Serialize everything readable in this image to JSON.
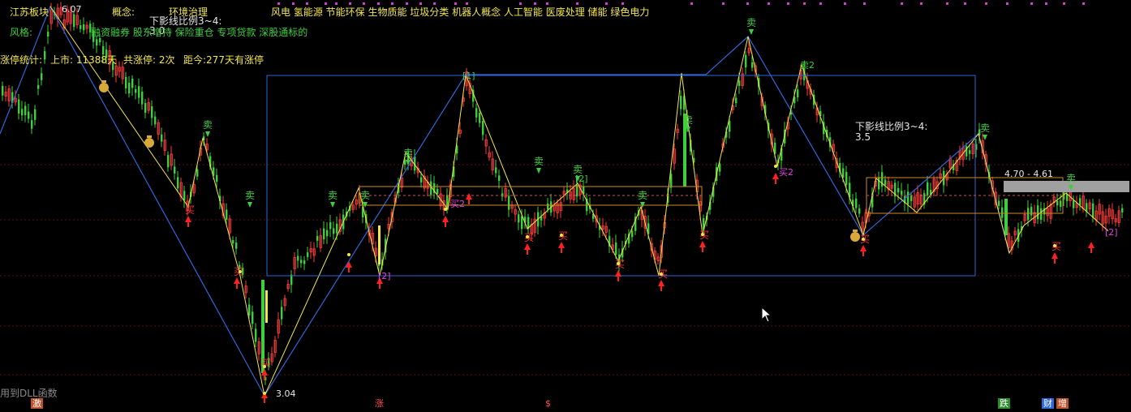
{
  "header": {
    "stock_name": "江苏板块",
    "concept_label": "概念:",
    "concept_primary": "环境治理",
    "concept_list": "风电 氢能源 节能环保 生物质能 垃圾分类 机器人概念 人工智能 医废处理 储能 绿色电力",
    "style_label": "风格:",
    "style_list": "融资融券 股东增持 保险重仓 专项贷款 深股通标的",
    "limit_label": "涨停统计:",
    "limit_days": "上市: 11388天",
    "limit_total": "共涨停: 2次",
    "limit_since": "距今:277天有涨停"
  },
  "annotations": {
    "high_price": "6.07",
    "low_price": "3.04",
    "shadow_ratio_top": "下影线比例3~4:",
    "shadow_ratio_top_val": "3.0",
    "shadow_ratio_right": "下影线比例3~4:",
    "shadow_ratio_right_val": "3.5",
    "range_label": "4.70 - 4.61",
    "dll_notice": "用到DLL函数"
  },
  "signals": {
    "sell": "卖",
    "buy": "买",
    "sell2": "卖2",
    "buy2": "买2",
    "bracket1": "[1]",
    "bracket2": "[2]"
  },
  "bottom_badges": {
    "ji": "激",
    "zhang": "涨",
    "dollar": "$",
    "die": "跌",
    "cai": "财",
    "zeng": "增"
  },
  "colors": {
    "up": "#ff3c3c",
    "down": "#3ecf3e",
    "yellow": "#f2e64a",
    "blue": "#2f66d8",
    "orange": "#d08a2a",
    "magenta": "#e040e0"
  }
}
